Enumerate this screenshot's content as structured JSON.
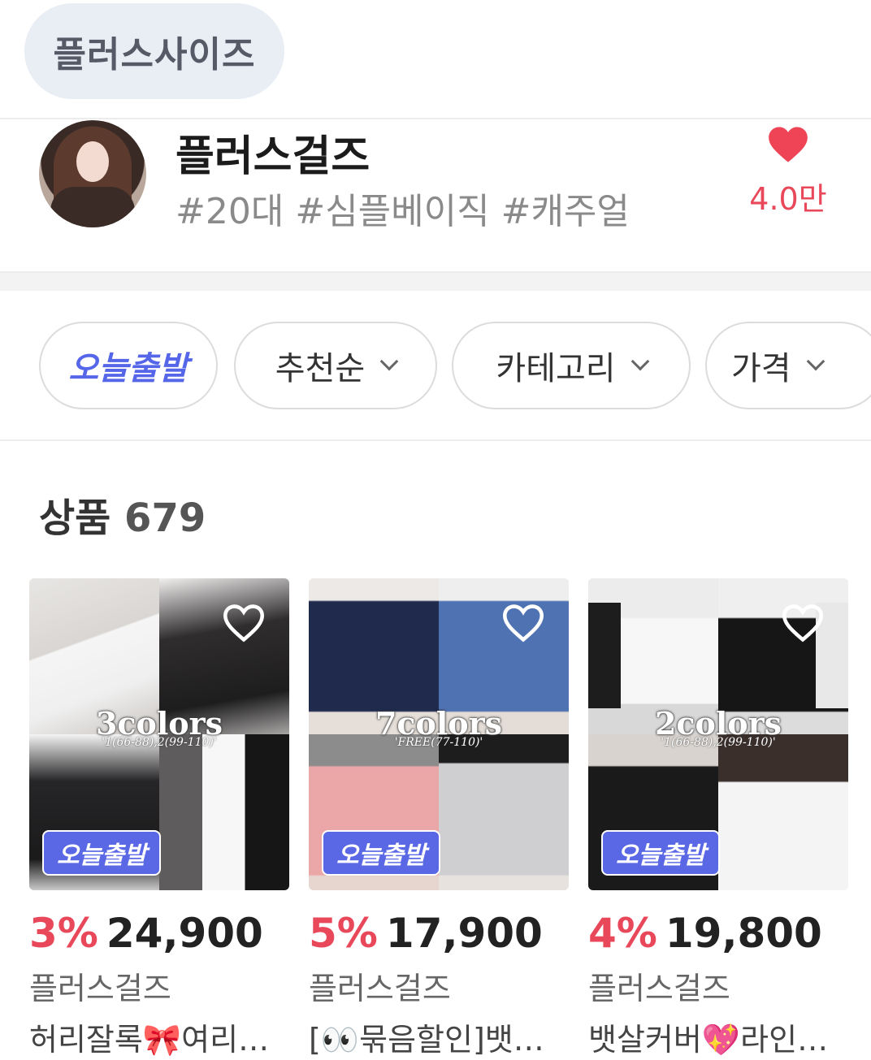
{
  "top_chip": {
    "label": "플러스사이즈"
  },
  "store": {
    "name": "플러스걸즈",
    "tags": "#20대 #심플베이직 #캐주얼",
    "likes": "4.0만"
  },
  "filters": {
    "today_label": "오늘출발",
    "sort_label": "추천순",
    "category_label": "카테고리",
    "price_label": "가격"
  },
  "products_header": {
    "label": "상품",
    "count": "679"
  },
  "products": [
    {
      "colors_text": "3colors",
      "size_text": "'1(66-88),2(99-110)'",
      "badge": "오늘출발",
      "discount": "3%",
      "price": "24,900",
      "brand": "플러스걸즈",
      "name": "허리잘록🎀여리…"
    },
    {
      "colors_text": "7colors",
      "size_text": "'FREE(77-110)'",
      "badge": "오늘출발",
      "discount": "5%",
      "price": "17,900",
      "brand": "플러스걸즈",
      "name": "[👀묶음할인]뱃…"
    },
    {
      "colors_text": "2colors",
      "size_text": "'1(66-88),2(99-110)'",
      "badge": "오늘출발",
      "discount": "4%",
      "price": "19,800",
      "brand": "플러스걸즈",
      "name": "뱃살커버💖라인…"
    }
  ],
  "colors": {
    "accent_red": "#e8485a",
    "accent_blue": "#5b68e6"
  }
}
